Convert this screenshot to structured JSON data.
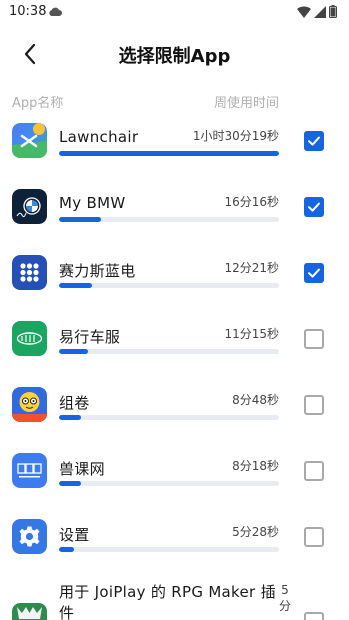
{
  "status_bar": {
    "time": "10:38"
  },
  "header": {
    "title": "选择限制App"
  },
  "columns": {
    "left": "App名称",
    "right": "周使用时间"
  },
  "colors": {
    "accent": "#1565e0",
    "track": "#e8ecf2"
  },
  "apps": [
    {
      "name": "Lawnchair",
      "time": "1小时30分19秒",
      "usage_ratio": 1.0,
      "checked": true,
      "icon": "lawnchair-icon"
    },
    {
      "name": "My BMW",
      "time": "16分16秒",
      "usage_ratio": 0.19,
      "checked": true,
      "icon": "bmw-icon"
    },
    {
      "name": "赛力斯蓝电",
      "time": "12分21秒",
      "usage_ratio": 0.15,
      "checked": true,
      "icon": "grid-dots-icon"
    },
    {
      "name": "易行车服",
      "time": "11分15秒",
      "usage_ratio": 0.13,
      "checked": false,
      "icon": "yixing-icon"
    },
    {
      "name": "组卷",
      "time": "8分48秒",
      "usage_ratio": 0.1,
      "checked": false,
      "icon": "zujuan-icon"
    },
    {
      "name": "兽课网",
      "time": "8分18秒",
      "usage_ratio": 0.1,
      "checked": false,
      "icon": "shoukewang-icon"
    },
    {
      "name": "设置",
      "time": "5分28秒",
      "usage_ratio": 0.07,
      "checked": false,
      "icon": "settings-gear-icon"
    },
    {
      "name": "用于 JoiPlay 的 RPG Maker 插件",
      "time": "5分",
      "usage_ratio": 0.06,
      "checked": false,
      "icon": "rpg-maker-icon"
    }
  ]
}
